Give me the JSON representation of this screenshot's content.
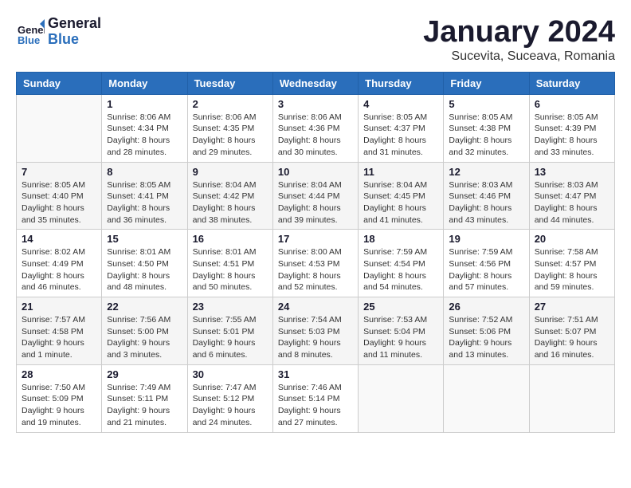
{
  "header": {
    "logo_line1": "General",
    "logo_line2": "Blue",
    "month_title": "January 2024",
    "subtitle": "Sucevita, Suceava, Romania"
  },
  "weekdays": [
    "Sunday",
    "Monday",
    "Tuesday",
    "Wednesday",
    "Thursday",
    "Friday",
    "Saturday"
  ],
  "weeks": [
    [
      {
        "day": "",
        "info": ""
      },
      {
        "day": "1",
        "info": "Sunrise: 8:06 AM\nSunset: 4:34 PM\nDaylight: 8 hours\nand 28 minutes."
      },
      {
        "day": "2",
        "info": "Sunrise: 8:06 AM\nSunset: 4:35 PM\nDaylight: 8 hours\nand 29 minutes."
      },
      {
        "day": "3",
        "info": "Sunrise: 8:06 AM\nSunset: 4:36 PM\nDaylight: 8 hours\nand 30 minutes."
      },
      {
        "day": "4",
        "info": "Sunrise: 8:05 AM\nSunset: 4:37 PM\nDaylight: 8 hours\nand 31 minutes."
      },
      {
        "day": "5",
        "info": "Sunrise: 8:05 AM\nSunset: 4:38 PM\nDaylight: 8 hours\nand 32 minutes."
      },
      {
        "day": "6",
        "info": "Sunrise: 8:05 AM\nSunset: 4:39 PM\nDaylight: 8 hours\nand 33 minutes."
      }
    ],
    [
      {
        "day": "7",
        "info": "Sunrise: 8:05 AM\nSunset: 4:40 PM\nDaylight: 8 hours\nand 35 minutes."
      },
      {
        "day": "8",
        "info": "Sunrise: 8:05 AM\nSunset: 4:41 PM\nDaylight: 8 hours\nand 36 minutes."
      },
      {
        "day": "9",
        "info": "Sunrise: 8:04 AM\nSunset: 4:42 PM\nDaylight: 8 hours\nand 38 minutes."
      },
      {
        "day": "10",
        "info": "Sunrise: 8:04 AM\nSunset: 4:44 PM\nDaylight: 8 hours\nand 39 minutes."
      },
      {
        "day": "11",
        "info": "Sunrise: 8:04 AM\nSunset: 4:45 PM\nDaylight: 8 hours\nand 41 minutes."
      },
      {
        "day": "12",
        "info": "Sunrise: 8:03 AM\nSunset: 4:46 PM\nDaylight: 8 hours\nand 43 minutes."
      },
      {
        "day": "13",
        "info": "Sunrise: 8:03 AM\nSunset: 4:47 PM\nDaylight: 8 hours\nand 44 minutes."
      }
    ],
    [
      {
        "day": "14",
        "info": "Sunrise: 8:02 AM\nSunset: 4:49 PM\nDaylight: 8 hours\nand 46 minutes."
      },
      {
        "day": "15",
        "info": "Sunrise: 8:01 AM\nSunset: 4:50 PM\nDaylight: 8 hours\nand 48 minutes."
      },
      {
        "day": "16",
        "info": "Sunrise: 8:01 AM\nSunset: 4:51 PM\nDaylight: 8 hours\nand 50 minutes."
      },
      {
        "day": "17",
        "info": "Sunrise: 8:00 AM\nSunset: 4:53 PM\nDaylight: 8 hours\nand 52 minutes."
      },
      {
        "day": "18",
        "info": "Sunrise: 7:59 AM\nSunset: 4:54 PM\nDaylight: 8 hours\nand 54 minutes."
      },
      {
        "day": "19",
        "info": "Sunrise: 7:59 AM\nSunset: 4:56 PM\nDaylight: 8 hours\nand 57 minutes."
      },
      {
        "day": "20",
        "info": "Sunrise: 7:58 AM\nSunset: 4:57 PM\nDaylight: 8 hours\nand 59 minutes."
      }
    ],
    [
      {
        "day": "21",
        "info": "Sunrise: 7:57 AM\nSunset: 4:58 PM\nDaylight: 9 hours\nand 1 minute."
      },
      {
        "day": "22",
        "info": "Sunrise: 7:56 AM\nSunset: 5:00 PM\nDaylight: 9 hours\nand 3 minutes."
      },
      {
        "day": "23",
        "info": "Sunrise: 7:55 AM\nSunset: 5:01 PM\nDaylight: 9 hours\nand 6 minutes."
      },
      {
        "day": "24",
        "info": "Sunrise: 7:54 AM\nSunset: 5:03 PM\nDaylight: 9 hours\nand 8 minutes."
      },
      {
        "day": "25",
        "info": "Sunrise: 7:53 AM\nSunset: 5:04 PM\nDaylight: 9 hours\nand 11 minutes."
      },
      {
        "day": "26",
        "info": "Sunrise: 7:52 AM\nSunset: 5:06 PM\nDaylight: 9 hours\nand 13 minutes."
      },
      {
        "day": "27",
        "info": "Sunrise: 7:51 AM\nSunset: 5:07 PM\nDaylight: 9 hours\nand 16 minutes."
      }
    ],
    [
      {
        "day": "28",
        "info": "Sunrise: 7:50 AM\nSunset: 5:09 PM\nDaylight: 9 hours\nand 19 minutes."
      },
      {
        "day": "29",
        "info": "Sunrise: 7:49 AM\nSunset: 5:11 PM\nDaylight: 9 hours\nand 21 minutes."
      },
      {
        "day": "30",
        "info": "Sunrise: 7:47 AM\nSunset: 5:12 PM\nDaylight: 9 hours\nand 24 minutes."
      },
      {
        "day": "31",
        "info": "Sunrise: 7:46 AM\nSunset: 5:14 PM\nDaylight: 9 hours\nand 27 minutes."
      },
      {
        "day": "",
        "info": ""
      },
      {
        "day": "",
        "info": ""
      },
      {
        "day": "",
        "info": ""
      }
    ]
  ]
}
